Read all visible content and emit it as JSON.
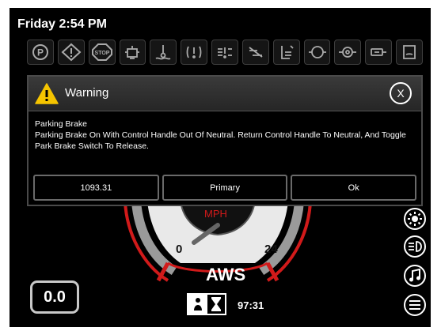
{
  "status_bar": {
    "time": "Friday 2:54 PM"
  },
  "tell_tales": [
    {
      "icon": "parking-brake-icon"
    },
    {
      "icon": "warning-diamond-icon"
    },
    {
      "icon": "stop-icon"
    },
    {
      "icon": "engine-hours-icon"
    },
    {
      "icon": "coolant-temp-icon"
    },
    {
      "icon": "hydraulic-warning-icon"
    },
    {
      "icon": "hydraulic-filter-icon"
    },
    {
      "icon": "air-filter-icon"
    },
    {
      "icon": "fuel-level-icon"
    },
    {
      "icon": "engine-oil-icon"
    },
    {
      "icon": "transmission-icon"
    },
    {
      "icon": "battery-charge-icon"
    },
    {
      "icon": "fluid-reservoir-icon"
    }
  ],
  "gauge": {
    "unit": "MPH",
    "min_label": "0",
    "max_label": "24",
    "mode": "AWS"
  },
  "speed_display": "0.0",
  "hours_value": "97:31",
  "right_controls": [
    {
      "icon": "brightness-icon"
    },
    {
      "icon": "headlight-icon"
    },
    {
      "icon": "music-icon"
    },
    {
      "icon": "menu-icon"
    }
  ],
  "warning_dialog": {
    "title": "Warning",
    "close_label": "X",
    "heading": "Parking Brake",
    "message": "Parking Brake On With Control Handle Out Of Neutral. Return Control Handle To Neutral, And Toggle Park Brake Switch To Release.",
    "buttons": [
      "1093.31",
      "Primary",
      "Ok"
    ]
  },
  "colors": {
    "background": "#000000",
    "warning_yellow": "#f5c400",
    "gauge_red": "#d11a1a",
    "text": "#ffffff"
  }
}
